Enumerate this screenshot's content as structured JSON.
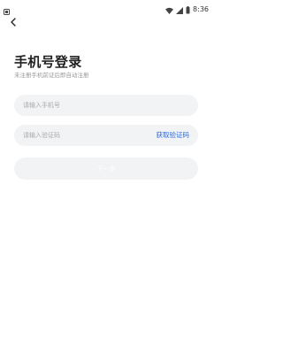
{
  "status_bar": {
    "time": "8:36",
    "icons": [
      "notification-icon",
      "wifi-icon",
      "signal-icon",
      "battery-icon"
    ]
  },
  "nav": {
    "back_icon": "chevron-left-icon"
  },
  "login": {
    "title": "手机号登录",
    "subtitle": "未注册手机前证后即自动注册",
    "phone_placeholder": "请输入手机号",
    "code_placeholder": "请输入验证码",
    "get_code_label": "获取验证码",
    "next_label": "下一步"
  },
  "colors": {
    "accent": "#2f6bd8",
    "field_bg": "#f2f3f5",
    "placeholder": "#aaaaaa",
    "title": "#222222",
    "subtitle": "#9a9a9a"
  }
}
